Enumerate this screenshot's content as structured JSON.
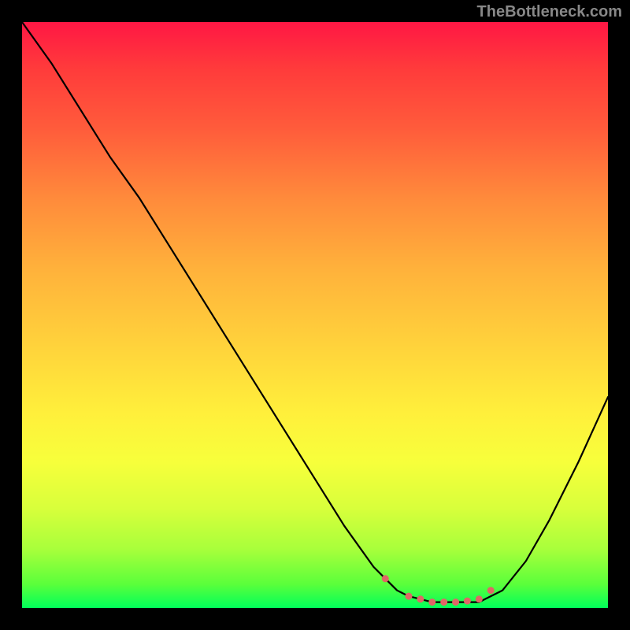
{
  "watermark": "TheBottleneck.com",
  "chart_data": {
    "type": "line",
    "title": "",
    "xlabel": "",
    "ylabel": "",
    "xlim": [
      0,
      100
    ],
    "ylim": [
      0,
      100
    ],
    "grid": false,
    "legend": false,
    "annotations": [],
    "background_gradient": {
      "orientation": "vertical",
      "stops": [
        {
          "pos": 0.0,
          "color": "#ff1744"
        },
        {
          "pos": 0.3,
          "color": "#ff8a3b"
        },
        {
          "pos": 0.67,
          "color": "#fff03b"
        },
        {
          "pos": 0.9,
          "color": "#a8ff3b"
        },
        {
          "pos": 1.0,
          "color": "#00ff5a"
        }
      ]
    },
    "series": [
      {
        "name": "curve",
        "color": "#000000",
        "x": [
          0,
          5,
          10,
          15,
          20,
          25,
          30,
          35,
          40,
          45,
          50,
          55,
          60,
          62,
          64,
          66,
          70,
          74,
          78,
          80,
          82,
          86,
          90,
          95,
          100
        ],
        "y": [
          100,
          93,
          85,
          77,
          70,
          62,
          54,
          46,
          38,
          30,
          22,
          14,
          7,
          5,
          3,
          2,
          1,
          1,
          1,
          2,
          3,
          8,
          15,
          25,
          36
        ]
      },
      {
        "name": "minimum-markers",
        "color": "#e06666",
        "type": "scatter",
        "x": [
          62,
          66,
          68,
          70,
          72,
          74,
          76,
          78,
          80
        ],
        "y": [
          5,
          2,
          1.5,
          1,
          1,
          1,
          1.2,
          1.5,
          3
        ]
      }
    ]
  }
}
